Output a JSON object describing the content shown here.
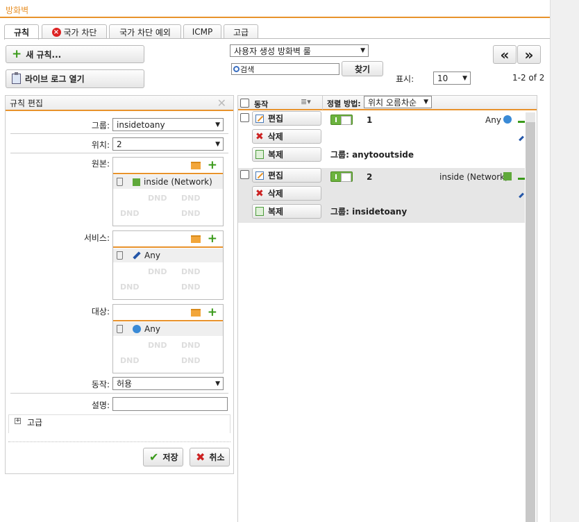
{
  "app": {
    "title": "방화벽"
  },
  "tabs": [
    {
      "label": "규칙"
    },
    {
      "label": "국가 차단"
    },
    {
      "label": "국가 차단 예외"
    },
    {
      "label": "ICMP"
    },
    {
      "label": "고급"
    }
  ],
  "toolbar": {
    "new_rule": "새 규칙...",
    "live_log": "라이브 로그 열기",
    "rule_filter": "사용자 생성 방화벽 룰",
    "search_placeholder": "검색",
    "search_button": "찾기",
    "prev": "«",
    "next": "»",
    "show_label": "표시:",
    "show_value": "10",
    "page_info": "1-2 of 2"
  },
  "editor": {
    "title": "규칙 편집",
    "group_label": "그룹:",
    "group_value": "insidetoany",
    "position_label": "위치:",
    "position_value": "2",
    "source_label": "원본:",
    "source_item": "inside (Network)",
    "service_label": "서비스:",
    "service_item": "Any",
    "dest_label": "대상:",
    "dest_item": "Any",
    "dnd": "DND",
    "action_label": "동작:",
    "action_value": "허용",
    "desc_label": "설명:",
    "desc_value": "",
    "advanced": "고급",
    "save": "저장",
    "cancel": "취소"
  },
  "list": {
    "col_action": "동작",
    "sort_label": "정렬 방법:",
    "sort_value": "위치 오름차순",
    "edit": "편집",
    "delete": "삭제",
    "copy": "복제",
    "group_prefix": "그룹:",
    "rows": [
      {
        "num": "1",
        "source": "Any",
        "group": "anytooutside"
      },
      {
        "num": "2",
        "source": "inside (Network)",
        "group": "insidetoany"
      }
    ]
  },
  "colors": {
    "accent": "#e8922b",
    "green": "#6cb33f",
    "red": "#cc2222"
  }
}
